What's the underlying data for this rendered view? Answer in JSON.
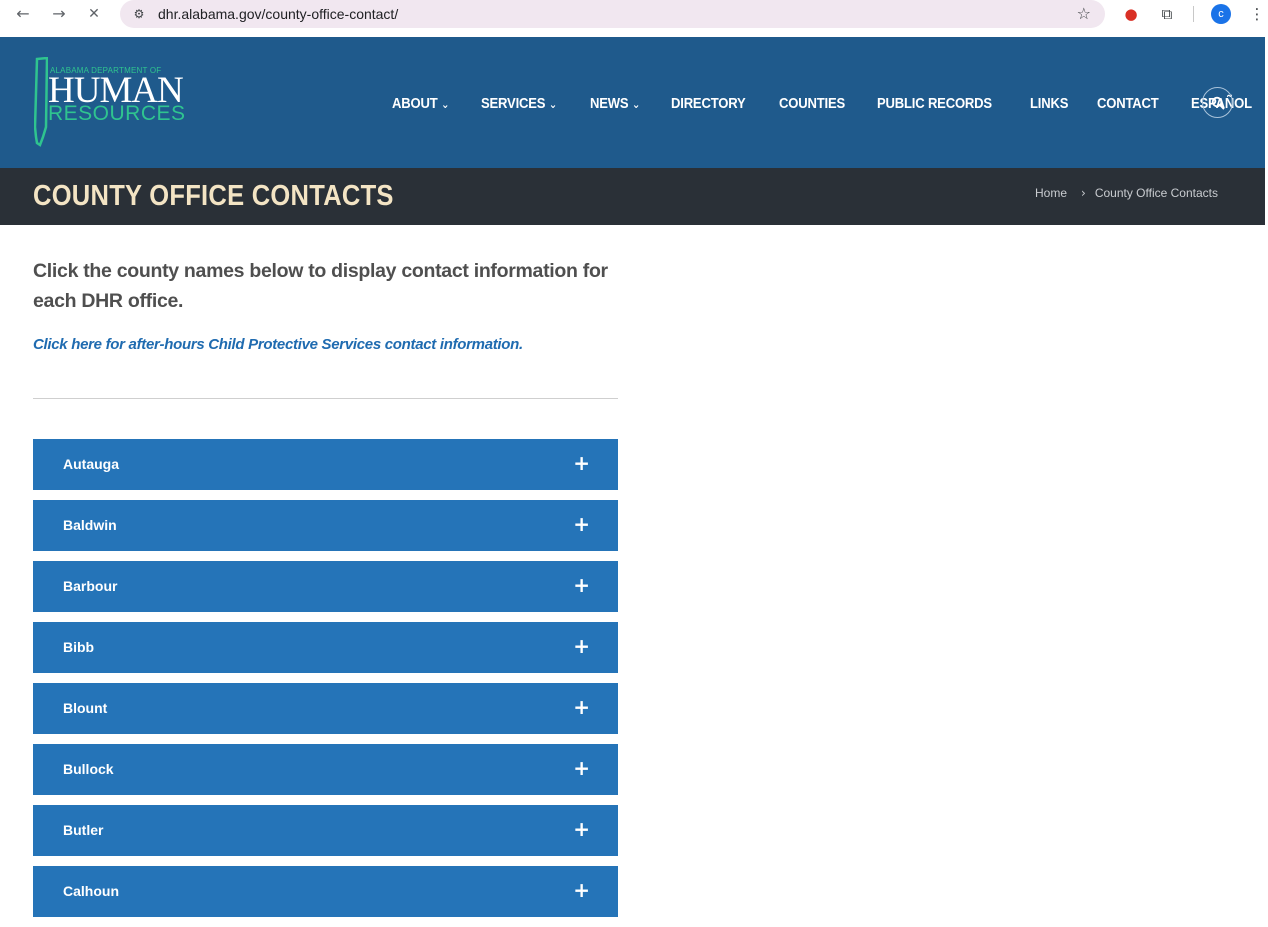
{
  "browser": {
    "url": "dhr.alabama.gov/county-office-contact/",
    "back_icon": "←",
    "forward_icon": "→",
    "stop_icon": "✕",
    "site_info_icon": "⚙",
    "star_icon": "☆",
    "extension_icon": "⧉",
    "menu_icon": "⋮",
    "profile_initial": "c"
  },
  "logo": {
    "top_text": "ALABAMA DEPARTMENT OF",
    "main_text": "HUMAN",
    "sub_text": "RESOURCES",
    "accent_color": "#2fc48f"
  },
  "nav": {
    "items": [
      {
        "label": "ABOUT",
        "has_dropdown": true
      },
      {
        "label": "SERVICES",
        "has_dropdown": true
      },
      {
        "label": "NEWS",
        "has_dropdown": true
      },
      {
        "label": "DIRECTORY",
        "has_dropdown": false
      },
      {
        "label": "COUNTIES",
        "has_dropdown": false
      },
      {
        "label": "PUBLIC RECORDS",
        "has_dropdown": false
      },
      {
        "label": "LINKS",
        "has_dropdown": false
      },
      {
        "label": "CONTACT",
        "has_dropdown": false
      },
      {
        "label": "ESPAÑOL",
        "has_dropdown": false
      }
    ],
    "chevron_icon": "⌄",
    "search_icon": "search-icon"
  },
  "title_bar": {
    "title": "COUNTY OFFICE CONTACTS",
    "breadcrumb_home": "Home",
    "breadcrumb_sep": "›",
    "breadcrumb_current": "County Office Contacts"
  },
  "content": {
    "intro": "Click the county names below to display contact information for each DHR office.",
    "after_hours_link": "Click here for after-hours Child Protective Services contact information.",
    "plus_icon": "+"
  },
  "counties": [
    "Autauga",
    "Baldwin",
    "Barbour",
    "Bibb",
    "Blount",
    "Bullock",
    "Butler",
    "Calhoun"
  ],
  "colors": {
    "header_bg": "#1f5a8c",
    "title_bar_bg": "#2a3037",
    "title_text": "#f3e4c4",
    "accordion_bg": "#2574b8",
    "link": "#1f6bb0"
  }
}
